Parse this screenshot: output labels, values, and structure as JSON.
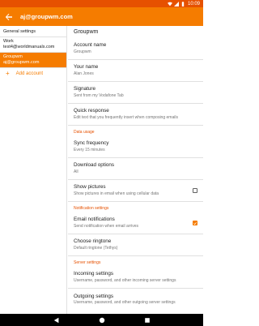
{
  "status": {
    "time": "10:09"
  },
  "app_bar": {
    "title": "aj@groupwm.com"
  },
  "left": {
    "general_settings": "General settings",
    "accounts": [
      {
        "name": "Work",
        "email": "test4@worldmanuals.com",
        "selected": false
      },
      {
        "name": "Groupwm",
        "email": "aj@groupwm.com",
        "selected": true
      }
    ],
    "add_account": "Add account"
  },
  "right": {
    "header": "Groupwm",
    "account_name": {
      "title": "Account name",
      "value": "Groupwm"
    },
    "your_name": {
      "title": "Your name",
      "value": "Alan Jones"
    },
    "signature": {
      "title": "Signature",
      "value": "Sent from my Vodafone Tab"
    },
    "quick_response": {
      "title": "Quick response",
      "value": "Edit text that you frequently insert when composing emails"
    },
    "data_usage_header": "Data usage",
    "sync_frequency": {
      "title": "Sync frequency",
      "value": "Every 15 minutes"
    },
    "download_options": {
      "title": "Download options",
      "value": "All"
    },
    "show_pictures": {
      "title": "Show pictures",
      "value": "Show pictures in email when using cellular data",
      "checked": false
    },
    "notification_header": "Notification settings",
    "email_notifications": {
      "title": "Email notifications",
      "value": "Send notification when email arrives",
      "checked": true
    },
    "ringtone": {
      "title": "Choose ringtone",
      "value": "Default ringtone (Tethys)"
    },
    "server_header": "Server settings",
    "incoming": {
      "title": "Incoming settings",
      "value": "Username, password, and other incoming server settings"
    },
    "outgoing": {
      "title": "Outgoing settings",
      "value": "Username, password, and other outgoing server settings"
    }
  },
  "colors": {
    "app_bar": "#f57c00",
    "status_bar": "#e65100",
    "accent": "#f57c00",
    "section_header": "#e65100"
  }
}
